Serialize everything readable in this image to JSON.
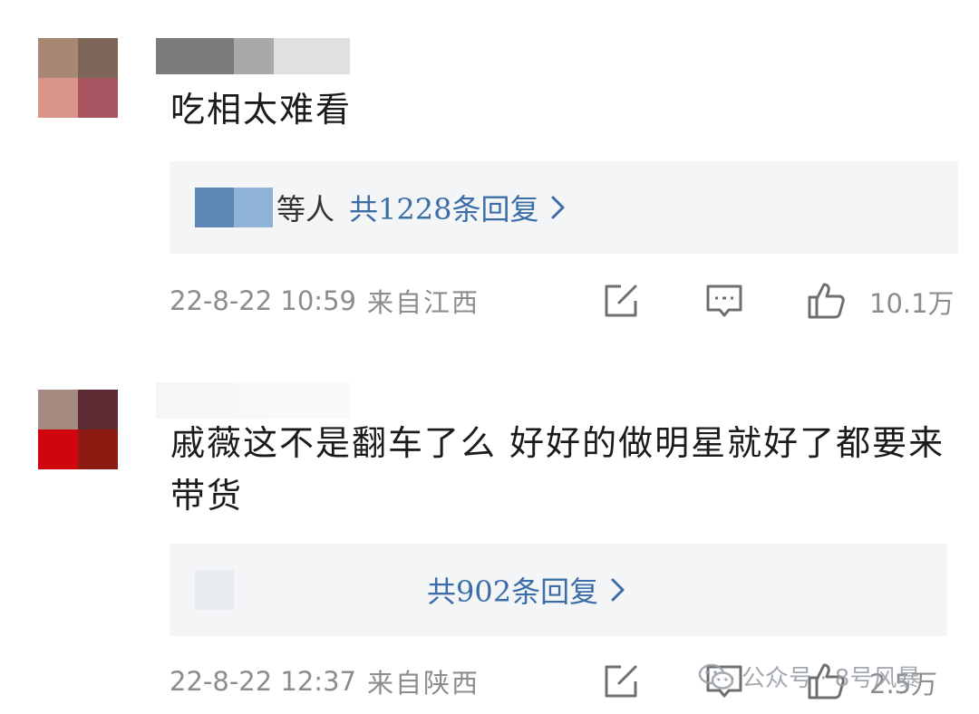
{
  "comments": [
    {
      "text": "吃相太难看",
      "reply_prefix": "等人",
      "reply_count": "共1228条回复",
      "time": "22-8-22 10:59",
      "location": "来自江西",
      "likes": "10.1万",
      "colors": {
        "avatar": [
          "#a88874",
          "#7d6657",
          "#d9958a",
          "#a95461"
        ],
        "username": [
          "#7b7b7b",
          "#a9a9a9",
          "#e0e0e0"
        ],
        "reply_avatar": [
          "#5e86b6",
          "#8fb2d8"
        ]
      }
    },
    {
      "text": "戚薇这不是翻车了么 好好的做明星就好了都要来带货",
      "reply_prefix": "",
      "reply_count": "共902条回复",
      "time": "22-8-22 12:37",
      "location": "来自陕西",
      "likes": "2.5万",
      "colors": {
        "avatar": [
          "#a48a80",
          "#5e2a33",
          "#d0050f",
          "#8d1b11"
        ],
        "username": [
          "#eeeeee",
          "#f2f2f2",
          "#f6f6f6"
        ],
        "reply_avatar": [
          "#e8ecf1",
          "#f4f5f6"
        ]
      }
    }
  ],
  "watermark": {
    "text": "公众号 · 8号风暴",
    "icon": "wechat-icon"
  },
  "theme": {
    "link_color": "#3b6ea8",
    "meta_color": "#8c8c8c",
    "reply_bg": "#f4f5f6"
  }
}
